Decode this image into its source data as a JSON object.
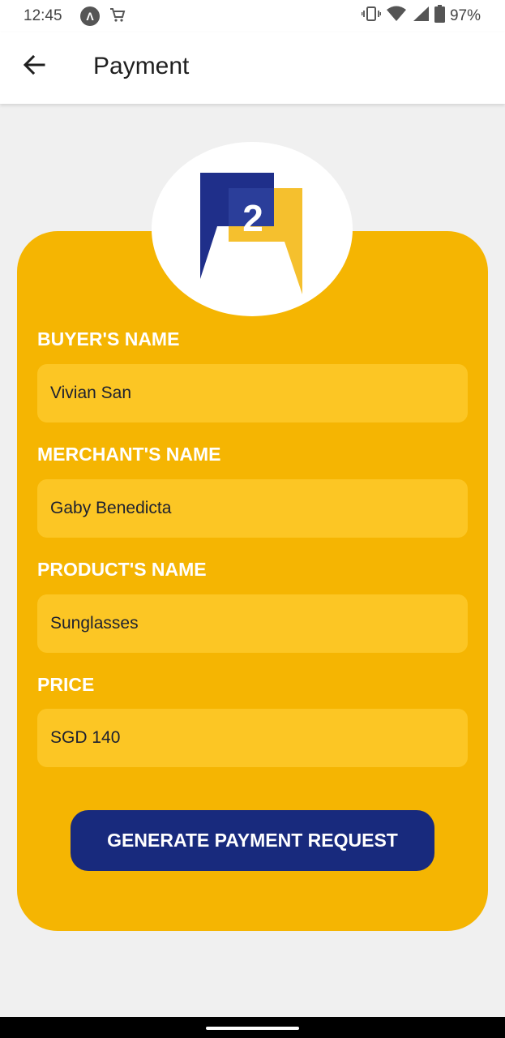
{
  "status_bar": {
    "time": "12:45",
    "battery": "97%",
    "icons": [
      "app-notification-icon",
      "shopping-cart-icon",
      "vibrate-icon",
      "wifi-icon",
      "signal-icon",
      "battery-icon"
    ]
  },
  "app_bar": {
    "title": "Payment",
    "back_icon": "arrow-left-icon"
  },
  "logo": {
    "number": "2",
    "colors": {
      "blue": "#1f2f8a",
      "yellow": "#f5c02e"
    }
  },
  "form": {
    "buyer": {
      "label": "BUYER'S NAME",
      "value": "Vivian San"
    },
    "merchant": {
      "label": "MERCHANT'S NAME",
      "value": "Gaby Benedicta"
    },
    "product": {
      "label": "PRODUCT'S NAME",
      "value": "Sunglasses"
    },
    "price": {
      "label": "PRICE",
      "value": "SGD 140"
    },
    "submit_label": "GENERATE PAYMENT REQUEST"
  },
  "colors": {
    "card": "#f5b502",
    "input": "#fcc624",
    "button": "#182a7d",
    "background": "#f0f0f0"
  }
}
